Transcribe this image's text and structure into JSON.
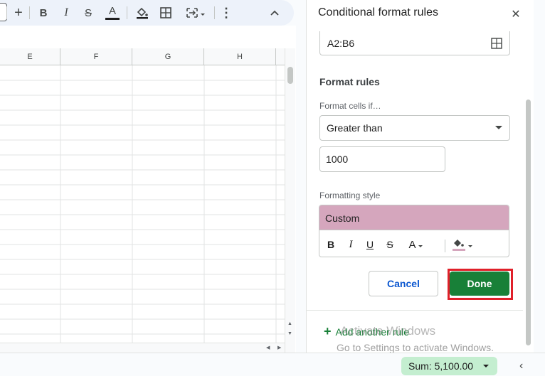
{
  "toolbar": {
    "icons": [
      "add-icon",
      "bold-icon",
      "italic-icon",
      "strikethrough-icon",
      "text-color-icon",
      "fill-color-icon",
      "borders-icon",
      "merge-cells-icon",
      "more-icon",
      "collapse-toolbar-icon"
    ],
    "bold_label": "B",
    "italic_label": "I",
    "strike_label": "S",
    "text_color_label": "A",
    "more_label": "⋮",
    "plus_label": "+"
  },
  "sheet": {
    "columns": [
      "E",
      "F",
      "G",
      "H"
    ],
    "row_count": 19
  },
  "panel": {
    "title": "Conditional format rules",
    "close_label": "✕",
    "range_value": "A2:B6",
    "format_rules_title": "Format rules",
    "format_cells_if_label": "Format cells if…",
    "condition_value": "Greater than",
    "value_input": "1000",
    "formatting_style_label": "Formatting style",
    "preview_text": "Custom",
    "style_buttons": {
      "bold": "B",
      "italic": "I",
      "underline": "U",
      "strikethrough": "S",
      "text_color": "A"
    },
    "preview_color": "#d5a6bd",
    "cancel_label": "Cancel",
    "done_label": "Done",
    "done_color": "#188038",
    "highlight_color": "#e0202a",
    "add_rule_label": "Add another rule",
    "add_rule_plus": "+"
  },
  "watermark": {
    "line1": "Activate Windows",
    "line2": "Go to Settings to activate Windows."
  },
  "status": {
    "sum_label": "Sum: 5,100.00",
    "collapse_label": "‹"
  }
}
